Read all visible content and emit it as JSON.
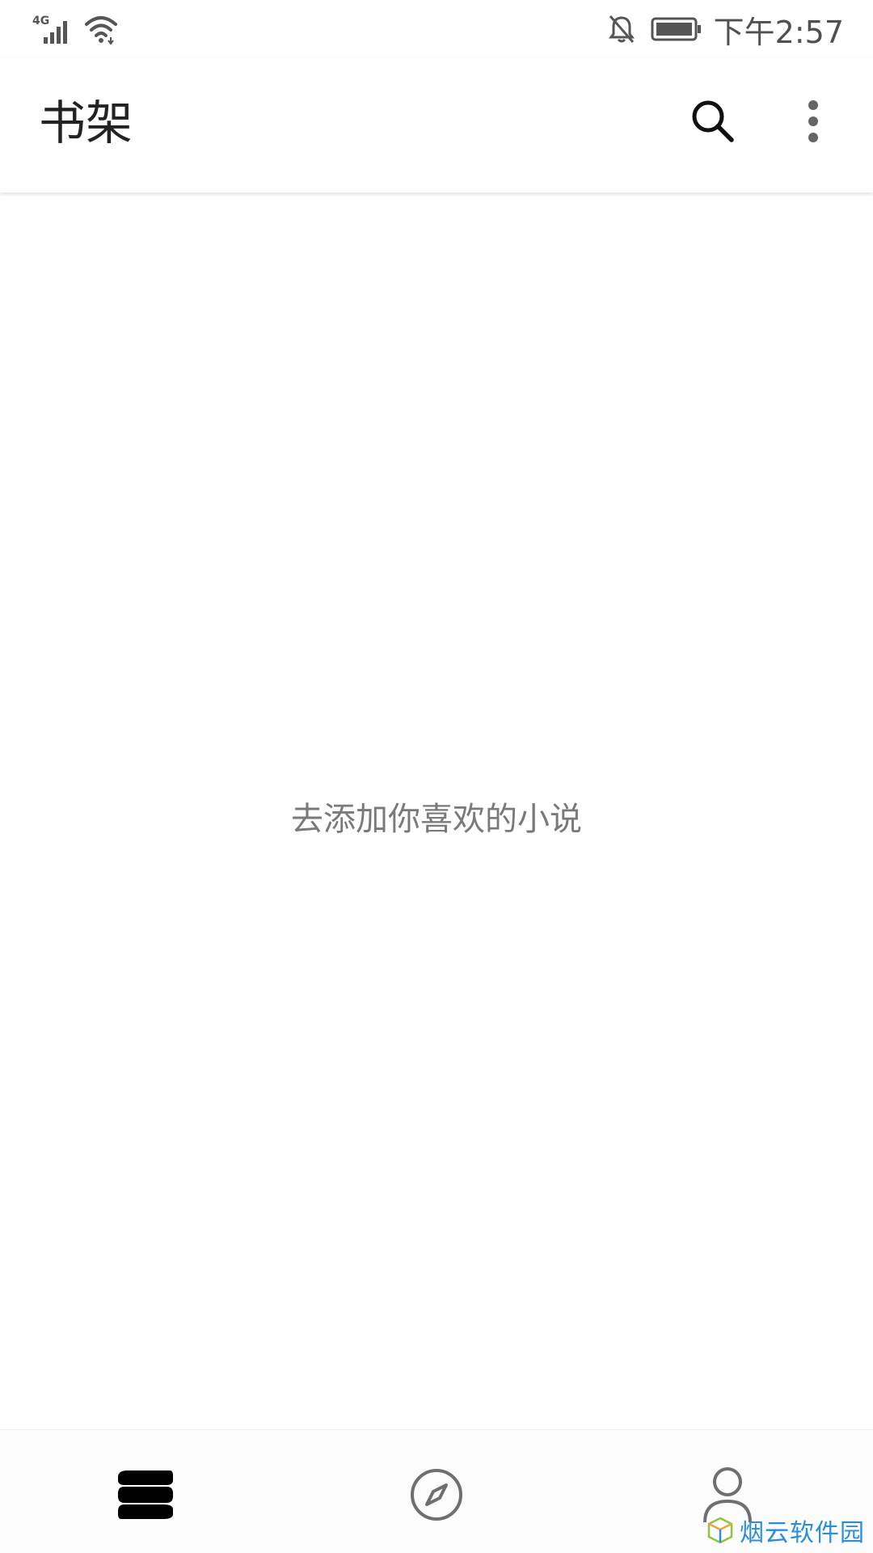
{
  "status_bar": {
    "network": "4G",
    "time": "下午2:57"
  },
  "app_bar": {
    "title": "书架"
  },
  "content": {
    "empty_hint": "去添加你喜欢的小说"
  },
  "bottom_nav": {
    "items": [
      {
        "id": "bookshelf",
        "icon": "bookshelf-icon",
        "active": true
      },
      {
        "id": "discover",
        "icon": "compass-icon",
        "active": false
      },
      {
        "id": "profile",
        "icon": "person-icon",
        "active": false
      }
    ]
  },
  "watermark": {
    "text": "烟云软件园"
  },
  "colors": {
    "title": "#222222",
    "hint": "#7a7a7a",
    "icon_active": "#000000",
    "icon_inactive": "#6f6f6f",
    "watermark": "#2a8fd8"
  }
}
